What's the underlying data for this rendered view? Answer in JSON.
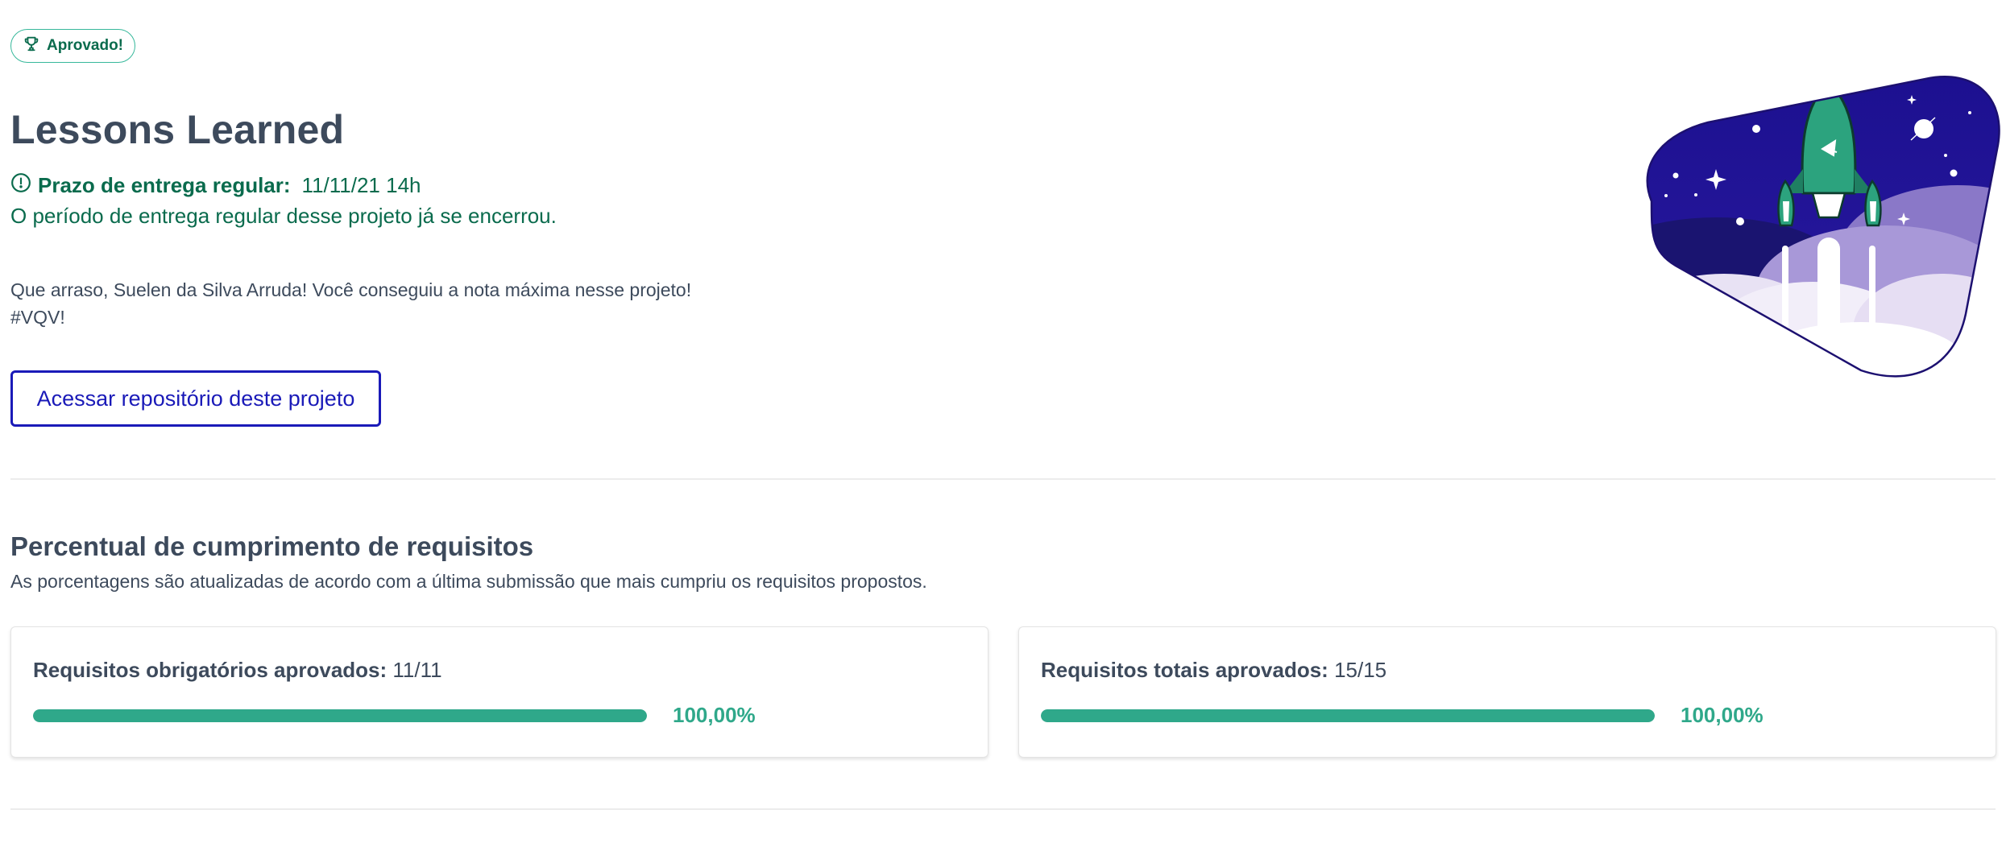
{
  "status_badge": {
    "icon": "trophy-icon",
    "label": "Aprovado!"
  },
  "project": {
    "title": "Lessons Learned"
  },
  "deadline": {
    "icon": "alert-circle-icon",
    "label": "Prazo de entrega regular:",
    "value": "11/11/21 14h",
    "message": "O período de entrega regular desse projeto já se encerrou."
  },
  "congrats": {
    "line1": "Que arraso, Suelen da Silva Arruda! Você conseguiu a nota máxima nesse projeto!",
    "line2": "#VQV!"
  },
  "repo_button": {
    "label": "Acessar repositório deste projeto"
  },
  "requirements": {
    "title": "Percentual de cumprimento de requisitos",
    "subtitle": "As porcentagens são atualizadas de acordo com a última submissão que mais cumpriu os requisitos propostos.",
    "cards": [
      {
        "label": "Requisitos obrigatórios aprovados:",
        "value": "11/11",
        "percent_text": "100,00%",
        "progress": 1.0
      },
      {
        "label": "Requisitos totais aprovados:",
        "value": "15/15",
        "percent_text": "100,00%",
        "progress": 1.0
      }
    ]
  },
  "colors": {
    "accent_green": "#0a6b4d",
    "progress_green": "#2fa88a",
    "button_blue": "#1a1ab8",
    "text_dark": "#3d4a5c"
  }
}
